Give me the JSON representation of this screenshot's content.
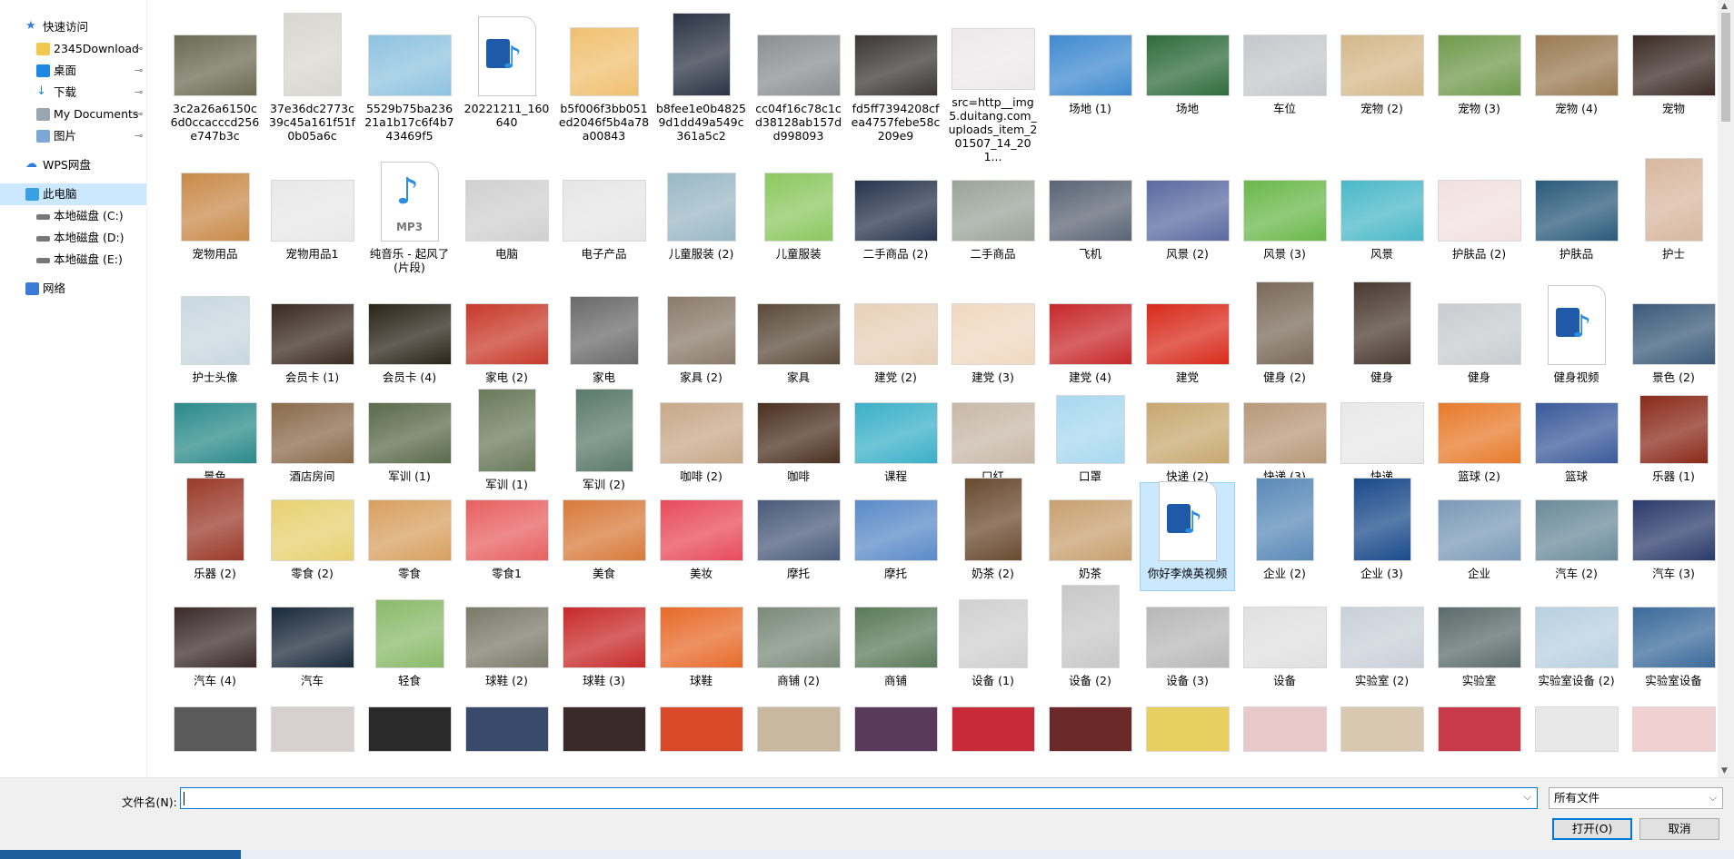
{
  "sidebar": {
    "items": [
      {
        "label": "快速访问",
        "icon": "star-icon",
        "color": "#3a7bd5",
        "indent": 0,
        "pinned": false
      },
      {
        "label": "2345Download",
        "icon": "folder-icon",
        "color": "#f2c94c",
        "indent": 1,
        "pinned": true
      },
      {
        "label": "桌面",
        "icon": "desktop-icon",
        "color": "#1e88e5",
        "indent": 1,
        "pinned": true
      },
      {
        "label": "下载",
        "icon": "download-icon",
        "color": "#1e88e5",
        "indent": 1,
        "pinned": true
      },
      {
        "label": "My Documents",
        "icon": "documents-icon",
        "color": "#9aa7b3",
        "indent": 1,
        "pinned": true
      },
      {
        "label": "图片",
        "icon": "pictures-icon",
        "color": "#7fa7d6",
        "indent": 1,
        "pinned": true
      },
      {
        "label": "WPS网盘",
        "icon": "cloud-icon",
        "color": "#2f7de1",
        "indent": 0,
        "pinned": false
      },
      {
        "label": "此电脑",
        "icon": "computer-icon",
        "color": "#3aa0e6",
        "indent": 0,
        "pinned": false,
        "selected": true
      },
      {
        "label": "本地磁盘 (C:)",
        "icon": "drive-icon",
        "color": "#777777",
        "indent": 1,
        "pinned": false
      },
      {
        "label": "本地磁盘 (D:)",
        "icon": "drive-icon",
        "color": "#777777",
        "indent": 1,
        "pinned": false
      },
      {
        "label": "本地磁盘 (E:)",
        "icon": "drive-icon",
        "color": "#777777",
        "indent": 1,
        "pinned": false
      },
      {
        "label": "网络",
        "icon": "network-icon",
        "color": "#3a7bd5",
        "indent": 0,
        "pinned": false
      }
    ],
    "pin_glyph": "📌"
  },
  "files": [
    {
      "name": "3c2a26a6150c6d0ccacccd256e747b3c",
      "kind": "image",
      "color": "#6b6a52"
    },
    {
      "name": "37e36dc2773c39c45a161f51f0b05a6c",
      "kind": "image-tall",
      "color": "#d9d6cf"
    },
    {
      "name": "5529b75ba23621a1b17c6f4b743469f5",
      "kind": "image",
      "color": "#8fc3e0"
    },
    {
      "name": "20221211_160640",
      "kind": "video-doc"
    },
    {
      "name": "b5f006f3bb051ed2046f5b4a78a00843",
      "kind": "image-square",
      "color": "#f0c070"
    },
    {
      "name": "b8fee1e0b48259d1dd49a549c361a5c2",
      "kind": "image-tall",
      "color": "#2b3444"
    },
    {
      "name": "cc04f16c78c1cd38128ab157dd998093",
      "kind": "image",
      "color": "#8a8f92"
    },
    {
      "name": "fd5ff7394208cfea4757febe58c209e9",
      "kind": "image",
      "color": "#3b3633"
    },
    {
      "name": "src=http__img5.duitang.com_uploads_item_201507_14_201...",
      "kind": "image",
      "color": "#ece9ea"
    },
    {
      "name": "场地 (1)",
      "kind": "image",
      "color": "#3f8ad0"
    },
    {
      "name": "场地",
      "kind": "image",
      "color": "#2e6b3a"
    },
    {
      "name": "车位",
      "kind": "image",
      "color": "#c4c8cc"
    },
    {
      "name": "宠物 (2)",
      "kind": "image",
      "color": "#d5b88a"
    },
    {
      "name": "宠物 (3)",
      "kind": "image",
      "color": "#6f9a4c"
    },
    {
      "name": "宠物 (4)",
      "kind": "image",
      "color": "#9a7a52"
    },
    {
      "name": "宠物",
      "kind": "image",
      "color": "#3a2a24"
    },
    {
      "name": "宠物用品",
      "kind": "image-square",
      "color": "#c98a4a"
    },
    {
      "name": "宠物用品1",
      "kind": "image",
      "color": "#e8e8e8"
    },
    {
      "name": "纯音乐 - 起风了(片段)",
      "kind": "mp3-doc"
    },
    {
      "name": "电脑",
      "kind": "image",
      "color": "#d0d0d0"
    },
    {
      "name": "电子产品",
      "kind": "image",
      "color": "#e6e6e6"
    },
    {
      "name": "儿童服装 (2)",
      "kind": "image-square",
      "color": "#9ab8c6"
    },
    {
      "name": "儿童服装",
      "kind": "image-square",
      "color": "#8cc860"
    },
    {
      "name": "二手商品 (2)",
      "kind": "image",
      "color": "#26344c"
    },
    {
      "name": "二手商品",
      "kind": "image",
      "color": "#9aa49a"
    },
    {
      "name": "飞机",
      "kind": "image",
      "color": "#5a6474"
    },
    {
      "name": "风景 (2)",
      "kind": "image",
      "color": "#5a6aa0"
    },
    {
      "name": "风景 (3)",
      "kind": "image",
      "color": "#6ab84a"
    },
    {
      "name": "风景",
      "kind": "image",
      "color": "#4ab8c8"
    },
    {
      "name": "护肤品 (2)",
      "kind": "image",
      "color": "#f2e0e0"
    },
    {
      "name": "护肤品",
      "kind": "image",
      "color": "#2a5a7a"
    },
    {
      "name": "护士",
      "kind": "image-tall",
      "color": "#d8b8a0"
    },
    {
      "name": "护士头像",
      "kind": "image-square",
      "color": "#c8d8e0"
    },
    {
      "name": "会员卡 (1)",
      "kind": "image",
      "color": "#3a2a20"
    },
    {
      "name": "会员卡 (4)",
      "kind": "image",
      "color": "#2a2418"
    },
    {
      "name": "家电 (2)",
      "kind": "image",
      "color": "#c83a2a"
    },
    {
      "name": "家电",
      "kind": "image-square",
      "color": "#6a6a6a"
    },
    {
      "name": "家具 (2)",
      "kind": "image-square",
      "color": "#8a7a6a"
    },
    {
      "name": "家具",
      "kind": "image",
      "color": "#5a4a3a"
    },
    {
      "name": "建党 (2)",
      "kind": "image",
      "color": "#e8d0b8"
    },
    {
      "name": "建党 (3)",
      "kind": "image",
      "color": "#f0d8c0"
    },
    {
      "name": "建党 (4)",
      "kind": "image",
      "color": "#c8282a"
    },
    {
      "name": "建党",
      "kind": "image",
      "color": "#d82a1a"
    },
    {
      "name": "健身 (2)",
      "kind": "image-tall",
      "color": "#7a6a5a"
    },
    {
      "name": "健身",
      "kind": "image-tall",
      "color": "#4a3a30"
    },
    {
      "name": "健身",
      "kind": "image",
      "color": "#c8ccd0"
    },
    {
      "name": "健身视频",
      "kind": "video-doc"
    },
    {
      "name": "景色 (2)",
      "kind": "image",
      "color": "#3a5a7a"
    },
    {
      "name": "景色",
      "kind": "image",
      "color": "#2a8a8a"
    },
    {
      "name": "酒店房间",
      "kind": "image",
      "color": "#8a6a4a"
    },
    {
      "name": "军训 (1)",
      "kind": "image",
      "color": "#5a6a4a"
    },
    {
      "name": "军训 (1)",
      "kind": "image-tall",
      "color": "#6a7a5a"
    },
    {
      "name": "军训 (2)",
      "kind": "image-tall",
      "color": "#5a7a6a"
    },
    {
      "name": "咖啡 (2)",
      "kind": "image",
      "color": "#c8a888"
    },
    {
      "name": "咖啡",
      "kind": "image",
      "color": "#4a3020"
    },
    {
      "name": "课程",
      "kind": "image",
      "color": "#3ab0c8"
    },
    {
      "name": "口红",
      "kind": "image",
      "color": "#c8b8a8"
    },
    {
      "name": "口罩",
      "kind": "image-square",
      "color": "#a8d8f0"
    },
    {
      "name": "快递 (2)",
      "kind": "image",
      "color": "#c8a870"
    },
    {
      "name": "快递 (3)",
      "kind": "image",
      "color": "#b89878"
    },
    {
      "name": "快递",
      "kind": "image",
      "color": "#e8e8e8"
    },
    {
      "name": "篮球 (2)",
      "kind": "image",
      "color": "#e87a2a"
    },
    {
      "name": "篮球",
      "kind": "image",
      "color": "#3a5a9a"
    },
    {
      "name": "乐器 (1)",
      "kind": "image-square",
      "color": "#8a2a1a"
    },
    {
      "name": "乐器 (2)",
      "kind": "image-tall",
      "color": "#9a3a2a"
    },
    {
      "name": "零食 (2)",
      "kind": "image",
      "color": "#e8d070"
    },
    {
      "name": "零食",
      "kind": "image",
      "color": "#d8a060"
    },
    {
      "name": "零食1",
      "kind": "image",
      "color": "#e86060"
    },
    {
      "name": "美食",
      "kind": "image",
      "color": "#d87a3a"
    },
    {
      "name": "美妆",
      "kind": "image",
      "color": "#e84a5a"
    },
    {
      "name": "摩托",
      "kind": "image",
      "color": "#4a5a7a"
    },
    {
      "name": "摩托",
      "kind": "image",
      "color": "#5a8ac8"
    },
    {
      "name": "奶茶 (2)",
      "kind": "image-tall",
      "color": "#6a4a30"
    },
    {
      "name": "奶茶",
      "kind": "image",
      "color": "#c8a070"
    },
    {
      "name": "你好李焕英视频",
      "kind": "video-doc",
      "selected": true
    },
    {
      "name": "企业 (2)",
      "kind": "image-tall",
      "color": "#5a8ab8"
    },
    {
      "name": "企业 (3)",
      "kind": "image-tall",
      "color": "#1a4a8a"
    },
    {
      "name": "企业",
      "kind": "image",
      "color": "#7a9ab8"
    },
    {
      "name": "汽车 (2)",
      "kind": "image",
      "color": "#6a8a9a"
    },
    {
      "name": "汽车 (3)",
      "kind": "image",
      "color": "#2a3a6a"
    },
    {
      "name": "汽车 (4)",
      "kind": "image",
      "color": "#3a2a2a"
    },
    {
      "name": "汽车",
      "kind": "image",
      "color": "#1a2a3a"
    },
    {
      "name": "轻食",
      "kind": "image-square",
      "color": "#8aba6a"
    },
    {
      "name": "球鞋 (2)",
      "kind": "image",
      "color": "#7a7a6a"
    },
    {
      "name": "球鞋 (3)",
      "kind": "image",
      "color": "#c82a2a"
    },
    {
      "name": "球鞋",
      "kind": "image",
      "color": "#e86a2a"
    },
    {
      "name": "商铺 (2)",
      "kind": "image",
      "color": "#7a8a7a"
    },
    {
      "name": "商铺",
      "kind": "image",
      "color": "#5a7a5a"
    },
    {
      "name": "设备 (1)",
      "kind": "image-square",
      "color": "#d0d0d0"
    },
    {
      "name": "设备 (2)",
      "kind": "image-tall",
      "color": "#c8c8c8"
    },
    {
      "name": "设备 (3)",
      "kind": "image",
      "color": "#b8b8b8"
    },
    {
      "name": "设备",
      "kind": "image",
      "color": "#e0e0e0"
    },
    {
      "name": "实验室 (2)",
      "kind": "image",
      "color": "#c8d0d8"
    },
    {
      "name": "实验室",
      "kind": "image",
      "color": "#5a6a6a"
    },
    {
      "name": "实验室设备 (2)",
      "kind": "image",
      "color": "#b8d0e0"
    },
    {
      "name": "实验室设备",
      "kind": "image",
      "color": "#3a6a9a"
    }
  ],
  "partial_row_colors": [
    "#5a5a5a",
    "#d8d0d0",
    "#2a2a2a",
    "#3a4a6a",
    "#3a2a2a",
    "#d84a2a",
    "#c8b8a0",
    "#5a3a5a",
    "#c82a3a",
    "#6a2a2a",
    "#e8d060",
    "#e8c8c8",
    "#d8c8b0",
    "#c83a4a",
    "#e8e8e8",
    "#f0d0d0"
  ],
  "bottom": {
    "filename_label": "文件名(N):",
    "filename_value": "",
    "filetype_value": "所有文件",
    "open_label": "打开(O)",
    "cancel_label": "取消"
  }
}
